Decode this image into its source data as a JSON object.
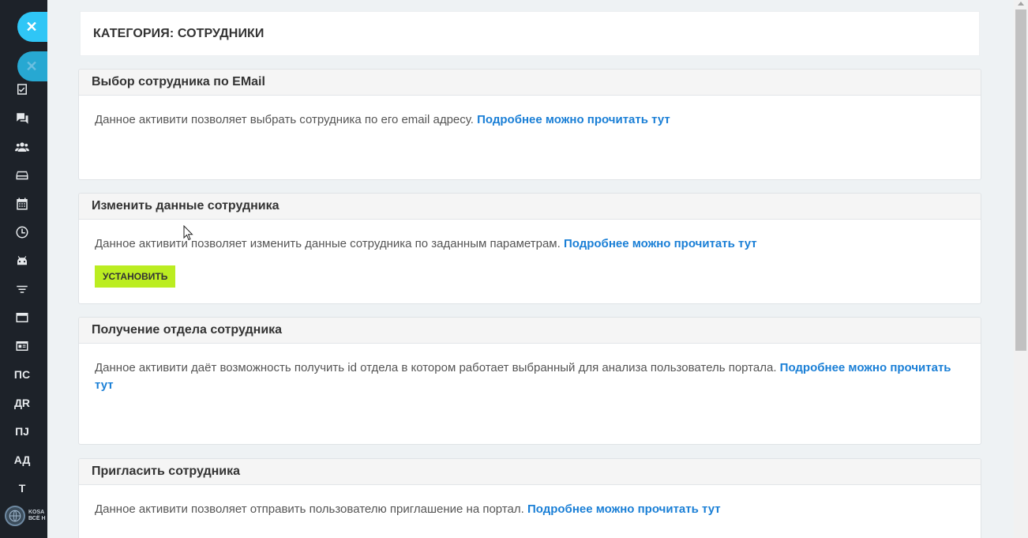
{
  "sidebar": {
    "close_glyph": "✕",
    "icons": [
      "checklist-icon",
      "chat-icon",
      "employees-icon",
      "drive-icon",
      "calendar-icon",
      "clock-icon",
      "robot-icon",
      "filter-icon",
      "window-icon",
      "contact-card-icon"
    ],
    "text_items": [
      "ПС",
      "ДR",
      "ПJ",
      "АД",
      "Т"
    ],
    "logo_text_line1": "KOSA",
    "logo_text_line2": "ВСЁ Н"
  },
  "page": {
    "category_title": "КАТЕГОРИЯ: СОТРУДНИКИ"
  },
  "cards": [
    {
      "title": "Выбор сотрудника по EMail",
      "description": "Данное активити позволяет выбрать сотрудника по его email адресу.",
      "link": "Подробнее можно прочитать тут"
    },
    {
      "title": "Изменить данные сотрудника",
      "description": "Данное активити позволяет изменить данные сотрудника по заданным параметрам.",
      "link": "Подробнее можно прочитать тут",
      "button": "УСТАНОВИТЬ"
    },
    {
      "title": "Получение отдела сотрудника",
      "description": "Данное активити даёт возможность получить id отдела в котором работает выбранный для анализа пользователь портала.",
      "link": "Подробнее можно прочитать тут"
    },
    {
      "title": "Пригласить сотрудника",
      "description": "Данное активити позволяет отправить пользователю приглашение на портал.",
      "link": "Подробнее можно прочитать тут"
    }
  ],
  "colors": {
    "sidebar_bg": "#1d2229",
    "accent_blue": "#2fc6f6",
    "link": "#1a7fd6",
    "install_button": "#bbed21"
  }
}
